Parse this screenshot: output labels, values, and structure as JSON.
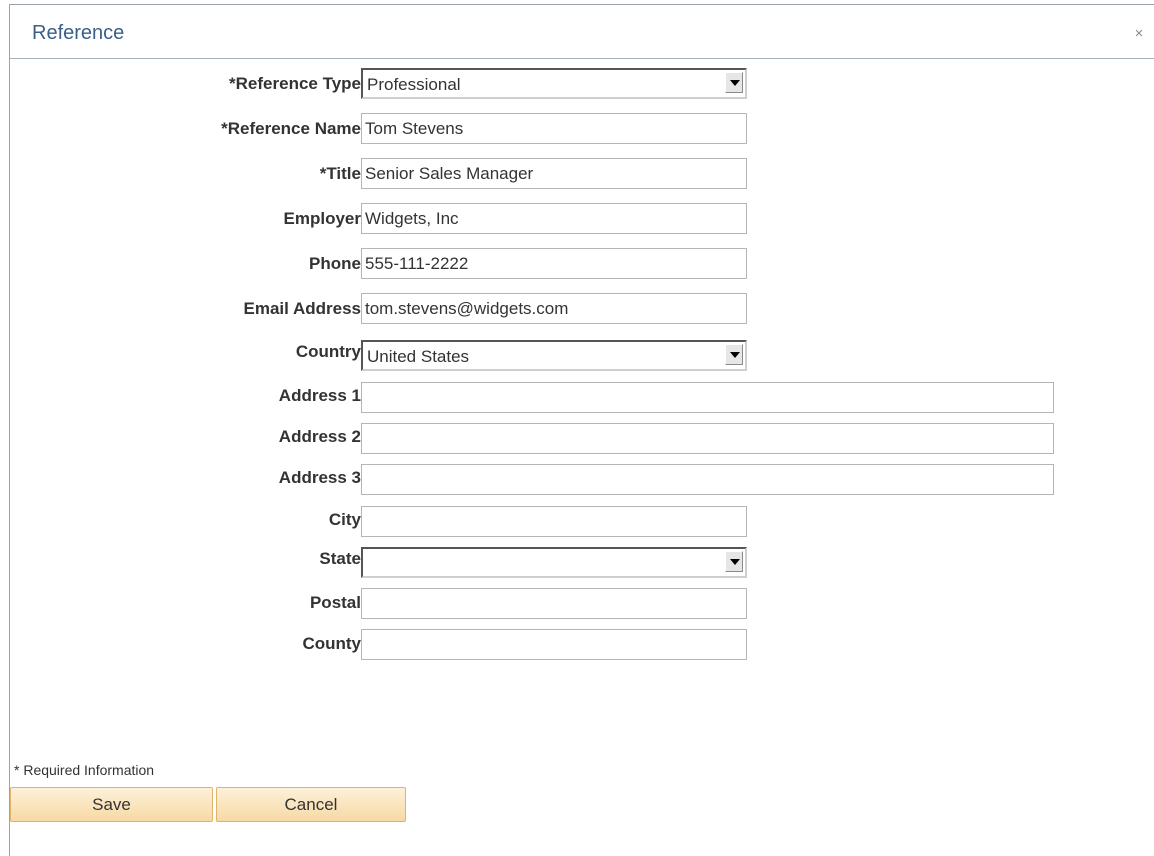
{
  "dialog": {
    "title": "Reference",
    "close_icon_glyph": "×"
  },
  "form": {
    "reference_type": {
      "label": "*Reference Type",
      "value": "Professional"
    },
    "reference_name": {
      "label": "*Reference Name",
      "value": "Tom Stevens"
    },
    "title": {
      "label": "*Title",
      "value": "Senior Sales Manager"
    },
    "employer": {
      "label": "Employer",
      "value": "Widgets, Inc"
    },
    "phone": {
      "label": "Phone",
      "value": "555-111-2222"
    },
    "email": {
      "label": "Email Address",
      "value": "tom.stevens@widgets.com"
    },
    "country": {
      "label": "Country",
      "value": "United States"
    },
    "address1": {
      "label": "Address 1",
      "value": ""
    },
    "address2": {
      "label": "Address 2",
      "value": ""
    },
    "address3": {
      "label": "Address 3",
      "value": ""
    },
    "city": {
      "label": "City",
      "value": ""
    },
    "state": {
      "label": "State",
      "value": ""
    },
    "postal": {
      "label": "Postal",
      "value": ""
    },
    "county": {
      "label": "County",
      "value": ""
    }
  },
  "footer": {
    "required_note": "* Required Information",
    "save_label": "Save",
    "cancel_label": "Cancel"
  },
  "colors": {
    "title": "#3a5f8a",
    "button_top": "#fdf1da",
    "button_bottom": "#f7d9a4",
    "button_border": "#e0b36a"
  }
}
